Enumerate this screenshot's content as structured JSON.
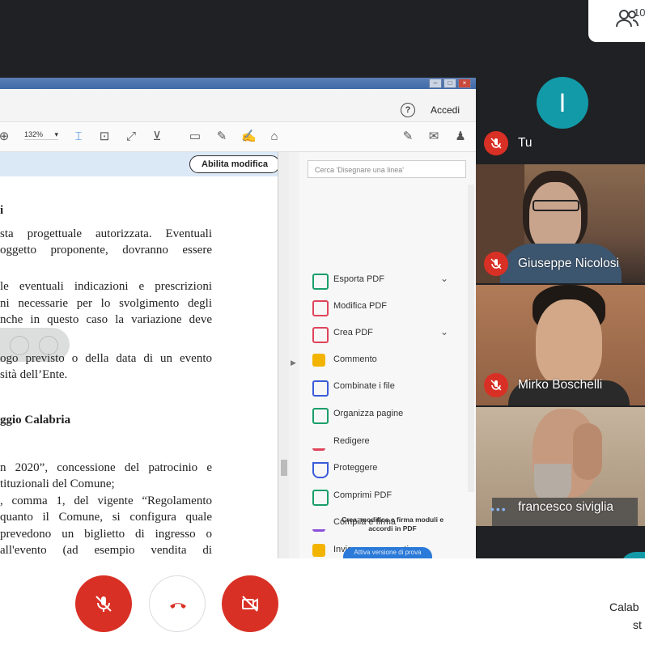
{
  "meet": {
    "participants_count": "10",
    "tiles": [
      {
        "name": "Tu",
        "initial": "I",
        "muted": true
      },
      {
        "name": "Giuseppe Nicolosi",
        "muted": true
      },
      {
        "name": "Mirko Boschelli",
        "muted": true
      },
      {
        "name": "francesco siviglia",
        "muted": false,
        "speaking_dots": "•••"
      }
    ],
    "bottom_right_line1": "Calab",
    "bottom_right_line2": "st"
  },
  "acrobat": {
    "accedi": "Accedi",
    "help": "?",
    "zoom": "132%",
    "abilita_modifica": "Abilita modifica",
    "search_placeholder": "Cerca 'Disegnare una linea'",
    "tools": [
      {
        "label": "Esporta PDF",
        "color": "#1a9e6a",
        "chevron": true
      },
      {
        "label": "Modifica PDF",
        "color": "#e0445b",
        "chevron": false
      },
      {
        "label": "Crea PDF",
        "color": "#e0445b",
        "chevron": true
      },
      {
        "label": "Commento",
        "color": "#f2b400",
        "chevron": false
      },
      {
        "label": "Combinate i file",
        "color": "#3a5bd9",
        "chevron": false
      },
      {
        "label": "Organizza pagine",
        "color": "#1a9e6a",
        "chevron": false
      },
      {
        "label": "Redigere",
        "color": "#e0445b",
        "chevron": false
      },
      {
        "label": "Proteggere",
        "color": "#3a5bd9",
        "chevron": false
      },
      {
        "label": "Comprimi PDF",
        "color": "#1a9e6a",
        "chevron": false
      },
      {
        "label": "Compila e firma",
        "color": "#8a4fd9",
        "chevron": false
      },
      {
        "label": "Invia per commenti",
        "color": "#f2b400",
        "chevron": false
      }
    ],
    "promo_text": "Crea, modifica e firma moduli e accordi in PDF",
    "promo_button": "Attiva versione di prova"
  },
  "document": {
    "lines": [
      {
        "text": "i",
        "bold": true
      },
      {
        "text": "sta progettuale autorizzata. Eventuali",
        "bold": false
      },
      {
        "text": "oggetto proponente, dovranno essere",
        "bold": false
      },
      {
        "text": "le eventuali indicazioni e prescrizioni",
        "bold": false
      },
      {
        "text": "ni necessarie per lo svolgimento degli",
        "bold": false
      },
      {
        "text": "nche in questo caso la variazione deve",
        "bold": false
      },
      {
        "text": "ogo previsto o della data di un evento",
        "bold": false
      },
      {
        "text": "sità dell’Ente.",
        "bold": false
      },
      {
        "text": "ggio Calabria",
        "bold": true
      },
      {
        "text": "n 2020”, concessione del patrocinio e",
        "bold": false
      },
      {
        "text": "tituzionali del Comune;",
        "bold": false
      },
      {
        "text": ", comma 1, del vigente “Regolamento",
        "bold": false
      },
      {
        "text": "quanto il Comune, si configura quale",
        "bold": false
      },
      {
        "text": "prevedono un biglietto di ingresso o",
        "bold": false
      },
      {
        "text": "all'evento (ad esempio vendita di",
        "bold": false
      }
    ]
  }
}
